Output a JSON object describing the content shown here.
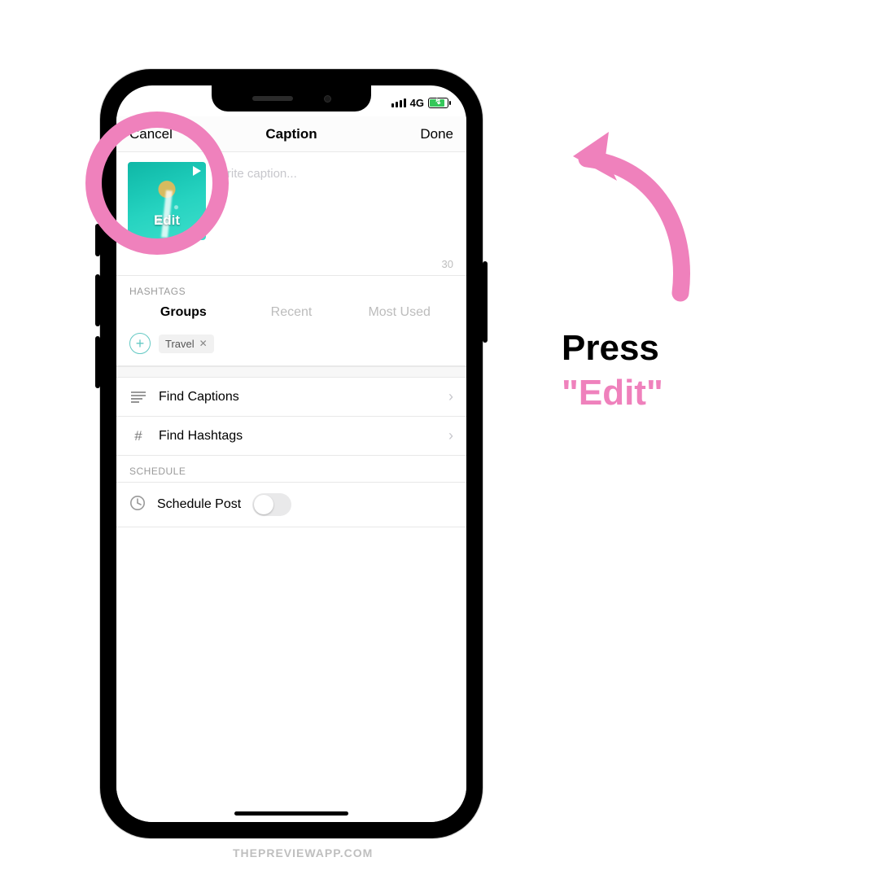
{
  "status": {
    "network": "4G"
  },
  "nav": {
    "left": "Cancel",
    "title": "Caption",
    "right": "Done"
  },
  "caption": {
    "placeholder": "Write caption...",
    "counter": "30",
    "thumb_label": "Edit"
  },
  "hashtags": {
    "header": "HASHTAGS",
    "tabs": {
      "groups": "Groups",
      "recent": "Recent",
      "most_used": "Most Used"
    },
    "chip": "Travel"
  },
  "rows": {
    "find_captions": "Find Captions",
    "find_hashtags": "Find Hashtags"
  },
  "schedule": {
    "header": "SCHEDULE",
    "label": "Schedule Post"
  },
  "callout": {
    "line1": "Press",
    "line2": "\"Edit\""
  },
  "watermark": "THEPREVIEWAPP.COM",
  "colors": {
    "accent": "#ef81bc"
  }
}
